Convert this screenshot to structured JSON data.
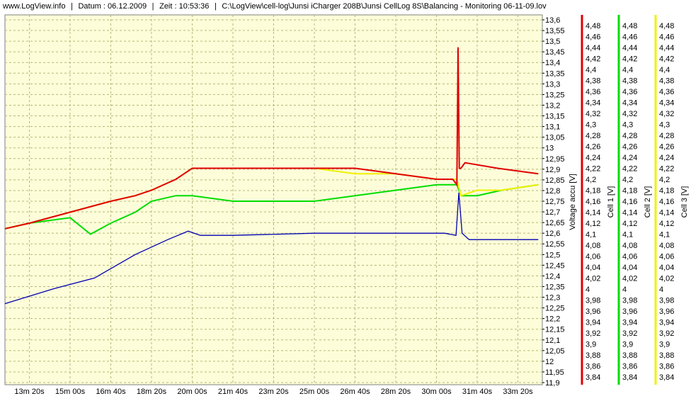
{
  "header": {
    "site": "www.LogView.info",
    "date": "Datum : 06.12.2009",
    "time": "Zeit : 10:53:36",
    "path": "C:\\LogView\\cell-log\\Junsi iCharger 208B\\Junsi CellLog 8S\\Balancing - Monitoring 06-11-09.lov"
  },
  "colors": {
    "plot_bg": "#fdfdd9",
    "grid": "#b8b87a",
    "voltage": "#0000b0",
    "cell1": "#e00000",
    "cell2": "#00dd00",
    "cell3": "#f0f000"
  },
  "chart_data": {
    "type": "line",
    "x_unit": "time",
    "x_ticks": [
      "13m 20s",
      "15m 00s",
      "16m 40s",
      "18m 20s",
      "20m 00s",
      "21m 40s",
      "23m 20s",
      "25m 00s",
      "26m 40s",
      "28m 20s",
      "30m 00s",
      "31m 40s",
      "33m 20s"
    ],
    "xlim_seconds": [
      740,
      2060
    ],
    "axes": [
      {
        "id": "voltage",
        "label": "Voltage accu [V]",
        "ylim": [
          11.9,
          13.6
        ],
        "ticks": [
          "13,6",
          "13,55",
          "13,5",
          "13,45",
          "13,4",
          "13,35",
          "13,3",
          "13,25",
          "13,2",
          "13,15",
          "13,1",
          "13,05",
          "13",
          "12,95",
          "12,9",
          "12,85",
          "12,8",
          "12,75",
          "12,7",
          "12,65",
          "12,6",
          "12,55",
          "12,5",
          "12,45",
          "12,4",
          "12,35",
          "12,3",
          "12,25",
          "12,2",
          "12,15",
          "12,1",
          "12,05",
          "12",
          "11,95",
          "11,9"
        ]
      },
      {
        "id": "cell1",
        "label": "Cell 1 [V]",
        "ylim": [
          3.83,
          4.49
        ],
        "ticks": [
          "4,48",
          "4,46",
          "4,44",
          "4,42",
          "4,4",
          "4,38",
          "4,36",
          "4,34",
          "4,32",
          "4,3",
          "4,28",
          "4,26",
          "4,24",
          "4,22",
          "4,2",
          "4,18",
          "4,16",
          "4,14",
          "4,12",
          "4,1",
          "4,08",
          "4,06",
          "4,04",
          "4,02",
          "4",
          "3,98",
          "3,96",
          "3,94",
          "3,92",
          "3,9",
          "3,88",
          "3,86",
          "3,84"
        ]
      },
      {
        "id": "cell2",
        "label": "Cell 2 [V]",
        "ylim": [
          3.83,
          4.49
        ],
        "ticks": [
          "4,48",
          "4,46",
          "4,44",
          "4,42",
          "4,4",
          "4,38",
          "4,36",
          "4,34",
          "4,32",
          "4,3",
          "4,28",
          "4,26",
          "4,24",
          "4,22",
          "4,2",
          "4,18",
          "4,16",
          "4,14",
          "4,12",
          "4,1",
          "4,08",
          "4,06",
          "4,04",
          "4,02",
          "4",
          "3,98",
          "3,96",
          "3,94",
          "3,92",
          "3,9",
          "3,88",
          "3,86",
          "3,84"
        ]
      },
      {
        "id": "cell3",
        "label": "Cell 3 [V]",
        "ylim": [
          3.83,
          4.49
        ],
        "ticks": [
          "4,48",
          "4,46",
          "4,44",
          "4,42",
          "4,4",
          "4,38",
          "4,36",
          "4,34",
          "4,32",
          "4,3",
          "4,28",
          "4,26",
          "4,24",
          "4,22",
          "4,2",
          "4,18",
          "4,16",
          "4,14",
          "4,12",
          "4,1",
          "4,08",
          "4,06",
          "4,04",
          "4,02",
          "4",
          "3,98",
          "3,96",
          "3,94",
          "3,92",
          "3,9",
          "3,88",
          "3,86",
          "3,84"
        ]
      }
    ],
    "series": [
      {
        "name": "Voltage accu [V]",
        "axis": "voltage",
        "x": [
          740,
          860,
          960,
          1060,
          1140,
          1190,
          1220,
          1300,
          1500,
          1700,
          1820,
          1848,
          1855,
          1863,
          1880,
          1960,
          2050
        ],
        "y": [
          12.27,
          12.34,
          12.39,
          12.5,
          12.57,
          12.61,
          12.59,
          12.59,
          12.6,
          12.6,
          12.6,
          12.59,
          12.79,
          12.6,
          12.57,
          12.57,
          12.57
        ]
      },
      {
        "name": "Cell 1 [V]",
        "axis": "cell1",
        "x": [
          740,
          800,
          900,
          1000,
          1060,
          1100,
          1160,
          1200,
          1300,
          1400,
          1500,
          1600,
          1700,
          1800,
          1840,
          1850,
          1853,
          1856,
          1860,
          1870,
          1950,
          2050
        ],
        "y": [
          4.11,
          4.12,
          4.14,
          4.16,
          4.17,
          4.18,
          4.2,
          4.22,
          4.22,
          4.22,
          4.22,
          4.22,
          4.21,
          4.2,
          4.2,
          4.19,
          4.44,
          4.22,
          4.22,
          4.23,
          4.22,
          4.21
        ]
      },
      {
        "name": "Cell 2 [V]",
        "axis": "cell2",
        "x": [
          740,
          800,
          900,
          950,
          1000,
          1060,
          1100,
          1160,
          1200,
          1300,
          1400,
          1500,
          1600,
          1700,
          1800,
          1850,
          1860,
          1900,
          1960,
          2050
        ],
        "y": [
          4.11,
          4.12,
          4.13,
          4.1,
          4.12,
          4.14,
          4.16,
          4.17,
          4.17,
          4.16,
          4.16,
          4.16,
          4.17,
          4.18,
          4.19,
          4.19,
          4.17,
          4.17,
          4.18,
          4.19
        ]
      },
      {
        "name": "Cell 3 [V]",
        "axis": "cell3",
        "x": [
          740,
          800,
          900,
          1000,
          1060,
          1100,
          1160,
          1200,
          1300,
          1400,
          1500,
          1600,
          1700,
          1800,
          1850,
          1860,
          1900,
          1960,
          2050
        ],
        "y": [
          4.11,
          4.12,
          4.14,
          4.16,
          4.17,
          4.18,
          4.2,
          4.22,
          4.22,
          4.22,
          4.22,
          4.21,
          4.21,
          4.2,
          4.2,
          4.17,
          4.18,
          4.18,
          4.19
        ]
      }
    ]
  }
}
